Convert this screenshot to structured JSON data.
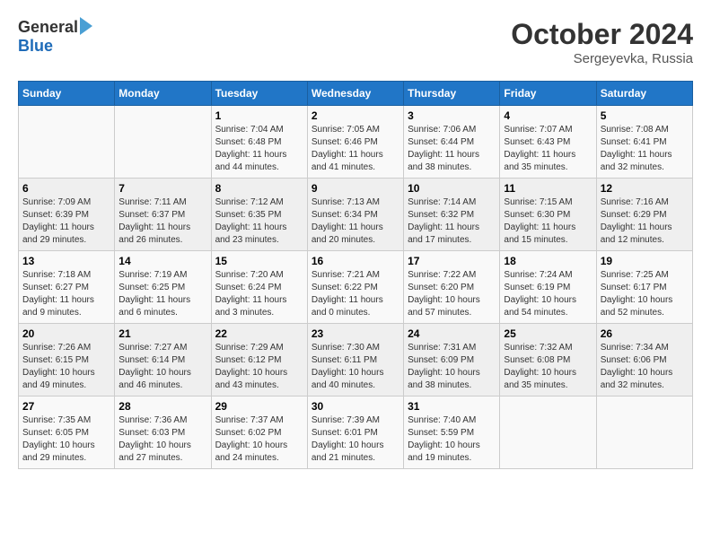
{
  "logo": {
    "general": "General",
    "blue": "Blue"
  },
  "title": {
    "month": "October 2024",
    "location": "Sergeyevka, Russia"
  },
  "weekdays": [
    "Sunday",
    "Monday",
    "Tuesday",
    "Wednesday",
    "Thursday",
    "Friday",
    "Saturday"
  ],
  "weeks": [
    [
      {
        "day": "",
        "sunrise": "",
        "sunset": "",
        "daylight": ""
      },
      {
        "day": "",
        "sunrise": "",
        "sunset": "",
        "daylight": ""
      },
      {
        "day": "1",
        "sunrise": "Sunrise: 7:04 AM",
        "sunset": "Sunset: 6:48 PM",
        "daylight": "Daylight: 11 hours and 44 minutes."
      },
      {
        "day": "2",
        "sunrise": "Sunrise: 7:05 AM",
        "sunset": "Sunset: 6:46 PM",
        "daylight": "Daylight: 11 hours and 41 minutes."
      },
      {
        "day": "3",
        "sunrise": "Sunrise: 7:06 AM",
        "sunset": "Sunset: 6:44 PM",
        "daylight": "Daylight: 11 hours and 38 minutes."
      },
      {
        "day": "4",
        "sunrise": "Sunrise: 7:07 AM",
        "sunset": "Sunset: 6:43 PM",
        "daylight": "Daylight: 11 hours and 35 minutes."
      },
      {
        "day": "5",
        "sunrise": "Sunrise: 7:08 AM",
        "sunset": "Sunset: 6:41 PM",
        "daylight": "Daylight: 11 hours and 32 minutes."
      }
    ],
    [
      {
        "day": "6",
        "sunrise": "Sunrise: 7:09 AM",
        "sunset": "Sunset: 6:39 PM",
        "daylight": "Daylight: 11 hours and 29 minutes."
      },
      {
        "day": "7",
        "sunrise": "Sunrise: 7:11 AM",
        "sunset": "Sunset: 6:37 PM",
        "daylight": "Daylight: 11 hours and 26 minutes."
      },
      {
        "day": "8",
        "sunrise": "Sunrise: 7:12 AM",
        "sunset": "Sunset: 6:35 PM",
        "daylight": "Daylight: 11 hours and 23 minutes."
      },
      {
        "day": "9",
        "sunrise": "Sunrise: 7:13 AM",
        "sunset": "Sunset: 6:34 PM",
        "daylight": "Daylight: 11 hours and 20 minutes."
      },
      {
        "day": "10",
        "sunrise": "Sunrise: 7:14 AM",
        "sunset": "Sunset: 6:32 PM",
        "daylight": "Daylight: 11 hours and 17 minutes."
      },
      {
        "day": "11",
        "sunrise": "Sunrise: 7:15 AM",
        "sunset": "Sunset: 6:30 PM",
        "daylight": "Daylight: 11 hours and 15 minutes."
      },
      {
        "day": "12",
        "sunrise": "Sunrise: 7:16 AM",
        "sunset": "Sunset: 6:29 PM",
        "daylight": "Daylight: 11 hours and 12 minutes."
      }
    ],
    [
      {
        "day": "13",
        "sunrise": "Sunrise: 7:18 AM",
        "sunset": "Sunset: 6:27 PM",
        "daylight": "Daylight: 11 hours and 9 minutes."
      },
      {
        "day": "14",
        "sunrise": "Sunrise: 7:19 AM",
        "sunset": "Sunset: 6:25 PM",
        "daylight": "Daylight: 11 hours and 6 minutes."
      },
      {
        "day": "15",
        "sunrise": "Sunrise: 7:20 AM",
        "sunset": "Sunset: 6:24 PM",
        "daylight": "Daylight: 11 hours and 3 minutes."
      },
      {
        "day": "16",
        "sunrise": "Sunrise: 7:21 AM",
        "sunset": "Sunset: 6:22 PM",
        "daylight": "Daylight: 11 hours and 0 minutes."
      },
      {
        "day": "17",
        "sunrise": "Sunrise: 7:22 AM",
        "sunset": "Sunset: 6:20 PM",
        "daylight": "Daylight: 10 hours and 57 minutes."
      },
      {
        "day": "18",
        "sunrise": "Sunrise: 7:24 AM",
        "sunset": "Sunset: 6:19 PM",
        "daylight": "Daylight: 10 hours and 54 minutes."
      },
      {
        "day": "19",
        "sunrise": "Sunrise: 7:25 AM",
        "sunset": "Sunset: 6:17 PM",
        "daylight": "Daylight: 10 hours and 52 minutes."
      }
    ],
    [
      {
        "day": "20",
        "sunrise": "Sunrise: 7:26 AM",
        "sunset": "Sunset: 6:15 PM",
        "daylight": "Daylight: 10 hours and 49 minutes."
      },
      {
        "day": "21",
        "sunrise": "Sunrise: 7:27 AM",
        "sunset": "Sunset: 6:14 PM",
        "daylight": "Daylight: 10 hours and 46 minutes."
      },
      {
        "day": "22",
        "sunrise": "Sunrise: 7:29 AM",
        "sunset": "Sunset: 6:12 PM",
        "daylight": "Daylight: 10 hours and 43 minutes."
      },
      {
        "day": "23",
        "sunrise": "Sunrise: 7:30 AM",
        "sunset": "Sunset: 6:11 PM",
        "daylight": "Daylight: 10 hours and 40 minutes."
      },
      {
        "day": "24",
        "sunrise": "Sunrise: 7:31 AM",
        "sunset": "Sunset: 6:09 PM",
        "daylight": "Daylight: 10 hours and 38 minutes."
      },
      {
        "day": "25",
        "sunrise": "Sunrise: 7:32 AM",
        "sunset": "Sunset: 6:08 PM",
        "daylight": "Daylight: 10 hours and 35 minutes."
      },
      {
        "day": "26",
        "sunrise": "Sunrise: 7:34 AM",
        "sunset": "Sunset: 6:06 PM",
        "daylight": "Daylight: 10 hours and 32 minutes."
      }
    ],
    [
      {
        "day": "27",
        "sunrise": "Sunrise: 7:35 AM",
        "sunset": "Sunset: 6:05 PM",
        "daylight": "Daylight: 10 hours and 29 minutes."
      },
      {
        "day": "28",
        "sunrise": "Sunrise: 7:36 AM",
        "sunset": "Sunset: 6:03 PM",
        "daylight": "Daylight: 10 hours and 27 minutes."
      },
      {
        "day": "29",
        "sunrise": "Sunrise: 7:37 AM",
        "sunset": "Sunset: 6:02 PM",
        "daylight": "Daylight: 10 hours and 24 minutes."
      },
      {
        "day": "30",
        "sunrise": "Sunrise: 7:39 AM",
        "sunset": "Sunset: 6:01 PM",
        "daylight": "Daylight: 10 hours and 21 minutes."
      },
      {
        "day": "31",
        "sunrise": "Sunrise: 7:40 AM",
        "sunset": "Sunset: 5:59 PM",
        "daylight": "Daylight: 10 hours and 19 minutes."
      },
      {
        "day": "",
        "sunrise": "",
        "sunset": "",
        "daylight": ""
      },
      {
        "day": "",
        "sunrise": "",
        "sunset": "",
        "daylight": ""
      }
    ]
  ]
}
